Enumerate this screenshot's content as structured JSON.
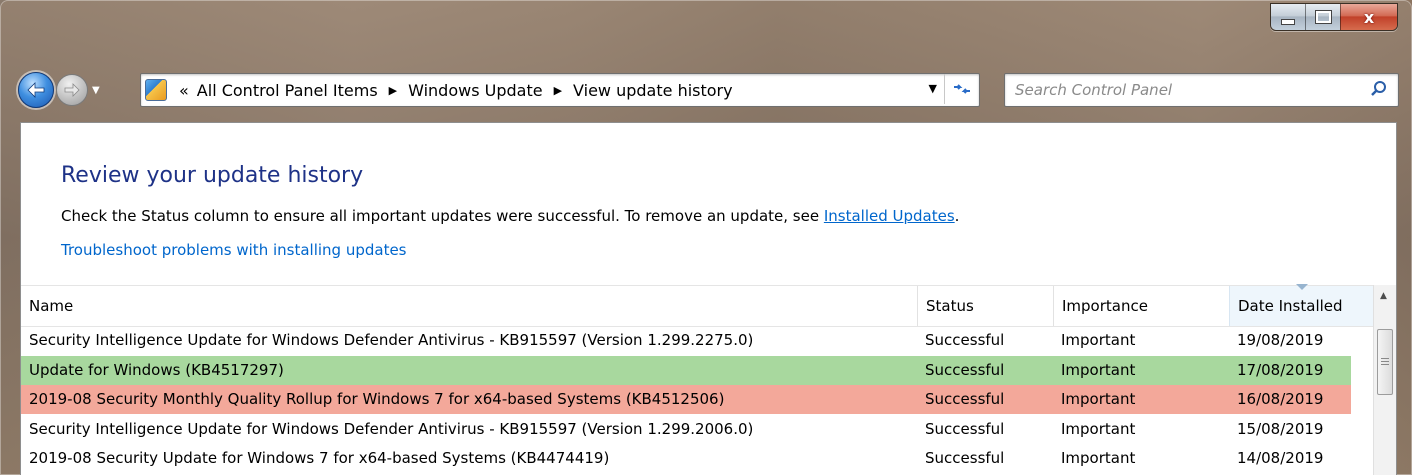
{
  "window": {
    "caption": {
      "minimize": "minimize",
      "maximize": "maximize",
      "close": "x"
    }
  },
  "nav": {
    "back_icon": "back-arrow-icon",
    "forward_icon": "forward-arrow-icon"
  },
  "address": {
    "overflow": "«",
    "breadcrumbs": [
      "All Control Panel Items",
      "Windows Update",
      "View update history"
    ],
    "refresh_icon": "refresh-icon"
  },
  "search": {
    "placeholder": "Search Control Panel"
  },
  "page": {
    "title": "Review your update history",
    "description_prefix": "Check the Status column to ensure all important updates were successful. To remove an update, see ",
    "description_link": "Installed Updates",
    "description_suffix": ".",
    "troubleshoot_link": "Troubleshoot problems with installing updates"
  },
  "table": {
    "columns": [
      "Name",
      "Status",
      "Importance",
      "Date Installed"
    ],
    "rows": [
      {
        "name": "Security Intelligence Update for Windows Defender Antivirus - KB915597 (Version 1.299.2275.0)",
        "status": "Successful",
        "importance": "Important",
        "date": "19/08/2019",
        "highlight": "none"
      },
      {
        "name": "Update for Windows (KB4517297)",
        "status": "Successful",
        "importance": "Important",
        "date": "17/08/2019",
        "highlight": "green"
      },
      {
        "name": "2019-08 Security Monthly Quality Rollup for Windows 7 for x64-based Systems (KB4512506)",
        "status": "Successful",
        "importance": "Important",
        "date": "16/08/2019",
        "highlight": "red"
      },
      {
        "name": "Security Intelligence Update for Windows Defender Antivirus - KB915597 (Version 1.299.2006.0)",
        "status": "Successful",
        "importance": "Important",
        "date": "15/08/2019",
        "highlight": "none"
      },
      {
        "name": "2019-08 Security Update for Windows 7 for x64-based Systems (KB4474419)",
        "status": "Successful",
        "importance": "Important",
        "date": "14/08/2019",
        "highlight": "none"
      }
    ]
  },
  "colors": {
    "title": "#1e3287",
    "link": "#0066cc",
    "row_green": "#a8d89e",
    "row_red": "#f3a89a"
  }
}
